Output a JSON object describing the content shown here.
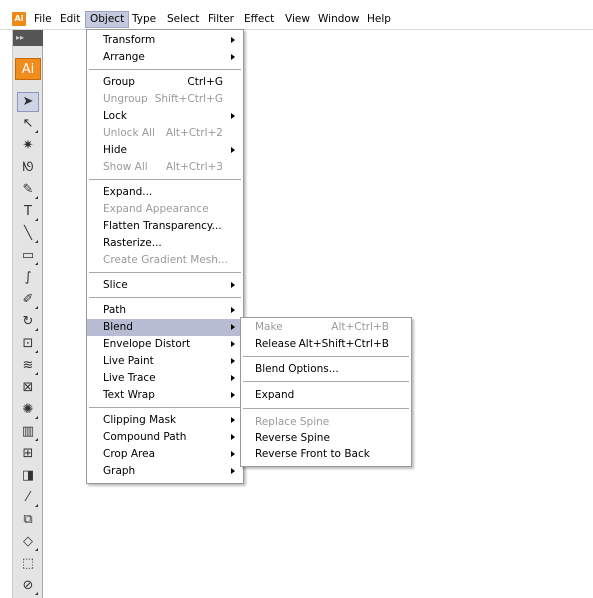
{
  "app": {
    "icon_text": "Ai",
    "logo_text": "Ai",
    "panel_grip": "▸▸"
  },
  "menubar": {
    "file": "File",
    "edit": "Edit",
    "object": "Object",
    "type": "Type",
    "select": "Select",
    "filter": "Filter",
    "effect": "Effect",
    "view": "View",
    "window": "Window",
    "help": "Help"
  },
  "object_menu": {
    "transform": "Transform",
    "arrange": "Arrange",
    "group": "Group",
    "group_sc": "Ctrl+G",
    "ungroup": "Ungroup",
    "ungroup_sc": "Shift+Ctrl+G",
    "lock": "Lock",
    "unlock_all": "Unlock All",
    "unlock_all_sc": "Alt+Ctrl+2",
    "hide": "Hide",
    "show_all": "Show All",
    "show_all_sc": "Alt+Ctrl+3",
    "expand": "Expand...",
    "expand_appearance": "Expand Appearance",
    "flatten_transparency": "Flatten Transparency...",
    "rasterize": "Rasterize...",
    "create_gradient_mesh": "Create Gradient Mesh...",
    "slice": "Slice",
    "path": "Path",
    "blend": "Blend",
    "envelope_distort": "Envelope Distort",
    "live_paint": "Live Paint",
    "live_trace": "Live Trace",
    "text_wrap": "Text Wrap",
    "clipping_mask": "Clipping Mask",
    "compound_path": "Compound Path",
    "crop_area": "Crop Area",
    "graph": "Graph"
  },
  "blend_submenu": {
    "make": "Make",
    "make_sc": "Alt+Ctrl+B",
    "release": "Release",
    "release_sc": "Alt+Shift+Ctrl+B",
    "blend_options": "Blend Options...",
    "expand": "Expand",
    "replace_spine": "Replace Spine",
    "reverse_spine": "Reverse Spine",
    "reverse_front_to_back": "Reverse Front to Back"
  },
  "colors": {
    "highlight": "#b8bcd3",
    "disabled_text": "#9a9a9a",
    "brand": "#f18d1c"
  },
  "tools": [
    "selection-tool",
    "direct-selection-tool",
    "magic-wand-tool",
    "lasso-tool",
    "pen-tool",
    "type-tool",
    "line-segment-tool",
    "rectangle-tool",
    "paintbrush-tool",
    "pencil-tool",
    "rotate-tool",
    "scale-tool",
    "warp-tool",
    "free-transform-tool",
    "symbol-sprayer-tool",
    "column-graph-tool",
    "mesh-tool",
    "gradient-tool",
    "eyedropper-tool",
    "blend-tool",
    "live-paint-bucket-tool",
    "live-paint-selection-tool",
    "slice-tool",
    "eraser-tool"
  ]
}
